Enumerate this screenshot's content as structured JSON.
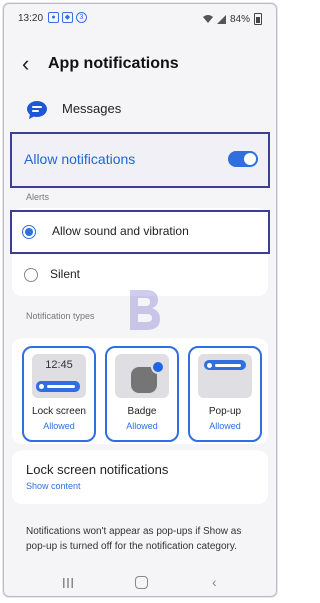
{
  "status_bar": {
    "time": "13:20",
    "icons": [
      "messages-status-icon",
      "gallery-status-icon",
      "notification-status-icon"
    ],
    "battery": "84%"
  },
  "header": {
    "title": "App notifications"
  },
  "app": {
    "name": "Messages"
  },
  "allow_notifications": {
    "label": "Allow notifications",
    "enabled": true
  },
  "alerts": {
    "section_label": "Alerts",
    "options": [
      {
        "label": "Allow sound and vibration",
        "selected": true
      },
      {
        "label": "Silent",
        "selected": false
      }
    ]
  },
  "notification_types": {
    "section_label": "Notification types",
    "items": [
      {
        "name": "Lock screen",
        "status": "Allowed",
        "preview_clock": "12:45"
      },
      {
        "name": "Badge",
        "status": "Allowed"
      },
      {
        "name": "Pop-up",
        "status": "Allowed"
      }
    ]
  },
  "lock_screen_notifications": {
    "title": "Lock screen notifications",
    "value": "Show content"
  },
  "footnote": "Notifications won't appear as pop-ups if Show as pop-up is turned off for the notification category.",
  "colors": {
    "accent": "#2f6fe0",
    "highlight_border": "#3c3f96"
  }
}
